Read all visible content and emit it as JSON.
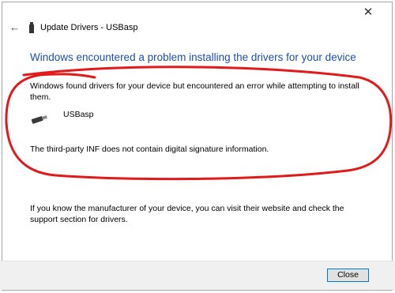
{
  "window": {
    "title": "Update Drivers - USBasp",
    "close_glyph": "✕",
    "back_glyph": "←"
  },
  "main": {
    "heading": "Windows encountered a problem installing the drivers for your device",
    "message": "Windows found drivers for your device but encountered an error while attempting to install them.",
    "device_name": "USBasp",
    "error_detail": "The third-party INF does not contain digital signature information.",
    "info": "If you know the manufacturer of your device, you can visit their website and check the support section for drivers."
  },
  "footer": {
    "close_label": "Close"
  },
  "icons": [
    "back-arrow-icon",
    "usb-device-icon",
    "close-icon"
  ],
  "colors": {
    "heading": "#1f4ea7",
    "annotation": "#e11b1b",
    "button_border": "#0078d7"
  }
}
